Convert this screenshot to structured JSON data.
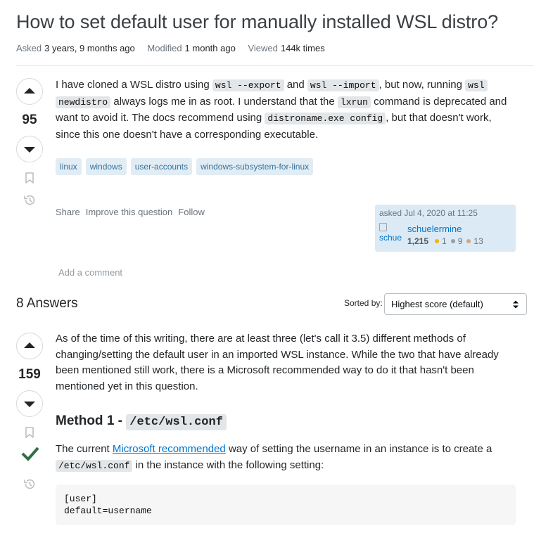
{
  "question": {
    "title": "How to set default user for manually installed WSL distro?",
    "meta": {
      "asked_label": "Asked",
      "asked_value": "3 years, 9 months ago",
      "modified_label": "Modified",
      "modified_value": "1 month ago",
      "viewed_label": "Viewed",
      "viewed_value": "144k times"
    },
    "score": "95",
    "body": {
      "t1": "I have cloned a WSL distro using ",
      "c1": "wsl --export",
      "t2": " and ",
      "c2": "wsl --import",
      "t3": ", but now, running ",
      "c3": "wsl",
      "c4": "newdistro",
      "t4": " always logs me in as root. I understand that the ",
      "c5": "lxrun",
      "t5": " command is deprecated and",
      "t6": "want to avoid it. The docs recommend using ",
      "c6": "distroname.exe config",
      "t7": ", but that doesn't work,",
      "t8": "since this one doesn't have a corresponding executable."
    },
    "tags": [
      "linux",
      "windows",
      "user-accounts",
      "windows-subsystem-for-linux"
    ],
    "menu": {
      "share": "Share",
      "improve": "Improve this question",
      "follow": "Follow"
    },
    "owner": {
      "asked_text": "asked Jul 4, 2020 at 11:25",
      "avatar_alt": "schue",
      "username": "schuelermine",
      "reputation": "1,215",
      "gold": "1",
      "silver": "9",
      "bronze": "13"
    },
    "add_comment": "Add a comment"
  },
  "answers_header": {
    "count_text": "8 Answers",
    "sort_label": "Sorted by:",
    "sort_value": "Highest score (default)"
  },
  "answer": {
    "score": "159",
    "p1": {
      "l1": "As of the time of this writing, there are at least three (let's call it 3.5) different methods of",
      "l2": "changing/setting the default user in an imported WSL instance. While the two that have already",
      "l3": "been mentioned still work, there is a Microsoft recommended way to do it that hasn't been",
      "l4": "mentioned yet in this question."
    },
    "method_heading": "Method 1 - ",
    "method_code": "/etc/wsl.conf",
    "p2": {
      "t1": "The current ",
      "link": "Microsoft recommended",
      "t2": " way of setting the username in an instance is to create a",
      "code": "/etc/wsl.conf",
      "t3": " in the instance with the following setting:"
    },
    "code_block": "[user]\ndefault=username"
  },
  "colors": {
    "accent": "#0074cc",
    "tag_bg": "#e1ecf4",
    "tag_fg": "#39739d",
    "accepted": "#2f6f44",
    "owner_bg": "#dbeaf5",
    "gold": "#f1b600",
    "silver": "#9a9fa4",
    "bronze": "#d1a684"
  },
  "icons": [
    "arrow-up-icon",
    "arrow-down-icon",
    "bookmark-icon",
    "history-icon",
    "accepted-check-icon",
    "select-caret-icon"
  ]
}
